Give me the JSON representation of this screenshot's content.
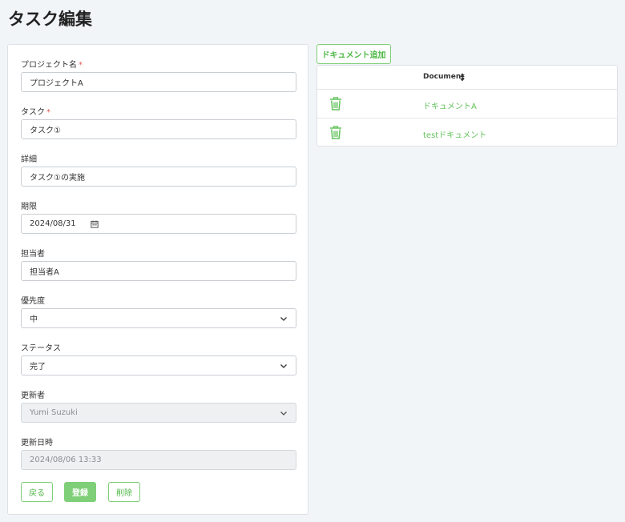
{
  "page": {
    "title": "タスク編集"
  },
  "form": {
    "project": {
      "label": "プロジェクト名",
      "required_mark": "*",
      "value": "プロジェクトA"
    },
    "task": {
      "label": "タスク",
      "required_mark": "*",
      "value": "タスク①"
    },
    "detail": {
      "label": "詳細",
      "value": "タスク①の実施"
    },
    "deadline": {
      "label": "期限",
      "value": "2024/08/31"
    },
    "assignee": {
      "label": "担当者",
      "value": "担当者A"
    },
    "priority": {
      "label": "優先度",
      "value": "中"
    },
    "status": {
      "label": "ステータス",
      "value": "完了"
    },
    "updater": {
      "label": "更新者",
      "value": "Yumi Suzuki"
    },
    "updated_at": {
      "label": "更新日時",
      "value": "2024/08/06 13:33"
    }
  },
  "buttons": {
    "back": "戻る",
    "register": "登録",
    "delete": "削除"
  },
  "documents": {
    "add_label": "ドキュメント追加",
    "column_header": "Document",
    "rows": [
      {
        "name": "ドキュメントA"
      },
      {
        "name": "testドキュメント"
      }
    ]
  },
  "colors": {
    "accent": "#7fcf78",
    "link": "#62c25a",
    "required": "#e05a5a",
    "background": "#f2f5f8"
  },
  "icons": {
    "trash": "trash-icon",
    "calendar": "calendar-icon",
    "chevron": "chevron-down-icon",
    "sort": "sort-icon"
  }
}
